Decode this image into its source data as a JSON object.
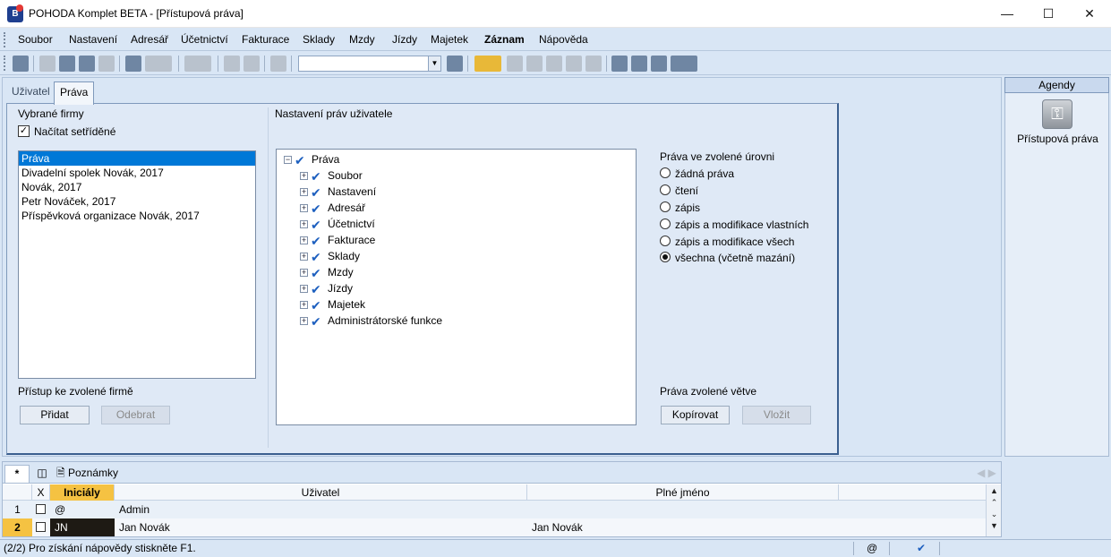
{
  "window": {
    "title": "POHODA Komplet BETA - [Přístupová práva]"
  },
  "menu": [
    "Soubor",
    "Nastavení",
    "Adresář",
    "Účetnictví",
    "Fakturace",
    "Sklady",
    "Mzdy",
    "Jízdy",
    "Majetek",
    "Záznam",
    "Nápověda"
  ],
  "tabs": {
    "users": "Uživatel",
    "rights": "Práva"
  },
  "firms": {
    "label": "Vybrané firmy",
    "sorted_label": "Načítat setříděné",
    "sorted_checked": true,
    "items": [
      "Práva",
      "Divadelní spolek Novák, 2017",
      "Novák, 2017",
      "Petr Nováček, 2017",
      "Příspěvková organizace Novák, 2017"
    ],
    "access_label": "Přístup ke zvolené firmě",
    "add_button": "Přidat",
    "remove_button": "Odebrat"
  },
  "rights": {
    "label": "Nastavení práv uživatele",
    "tree_root": "Práva",
    "tree_items": [
      "Soubor",
      "Nastavení",
      "Adresář",
      "Účetnictví",
      "Fakturace",
      "Sklady",
      "Mzdy",
      "Jízdy",
      "Majetek",
      "Administrátorské funkce"
    ],
    "level_label": "Práva ve zvolené úrovni",
    "levels": [
      "žádná práva",
      "čtení",
      "zápis",
      "zápis a modifikace vlastních",
      "zápis a modifikace všech",
      "všechna (včetně mazání)"
    ],
    "selected_level": "všechna (včetně mazání)",
    "branch_label": "Práva zvolené větve",
    "copy_button": "Kopírovat",
    "paste_button": "Vložit"
  },
  "sidebar": {
    "header": "Agendy",
    "item": "Přístupová práva"
  },
  "bottom": {
    "tab_star": "*",
    "tab_notes": "Poznámky",
    "columns": {
      "x": "X",
      "initials": "Iniciály",
      "user": "Uživatel",
      "full_name": "Plné jméno"
    },
    "rows": [
      {
        "num": "1",
        "initials": "@",
        "user": "Admin",
        "full_name": ""
      },
      {
        "num": "2",
        "initials": "JN",
        "user": "Jan Novák",
        "full_name": "Jan Novák"
      }
    ]
  },
  "status": {
    "text": "(2/2) Pro získání nápovědy stiskněte F1.",
    "at": "@"
  },
  "colors": {
    "selection": "#0078d7",
    "accent_column": "#f5c242",
    "tree_check": "#1d5fbf"
  },
  "icons": [
    "app-icon",
    "minimize-icon",
    "maximize-icon",
    "close-icon",
    "keys-icon",
    "check-icon",
    "filter-icon",
    "notes-icon"
  ]
}
